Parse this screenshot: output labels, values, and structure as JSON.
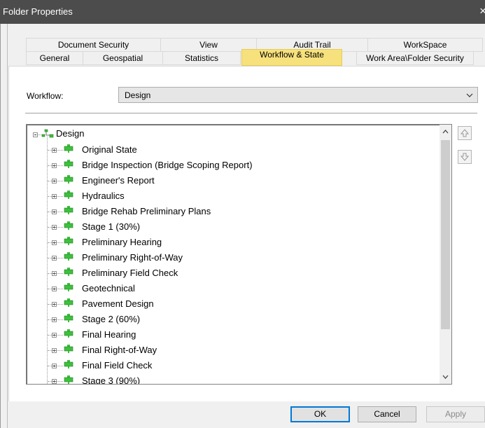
{
  "window": {
    "title": "Folder Properties",
    "close_glyph": "×"
  },
  "tabs": {
    "row1": [
      "Document Security",
      "View",
      "Audit Trail",
      "WorkSpace"
    ],
    "row2": [
      "General",
      "Geospatial",
      "Statistics",
      "Workflow & State",
      "Work Area\\Folder Security"
    ],
    "active": "Workflow & State"
  },
  "workflow": {
    "label": "Workflow:",
    "selected": "Design"
  },
  "tree": {
    "root": "Design",
    "states": [
      "Original State",
      "Bridge Inspection (Bridge Scoping Report)",
      "Engineer's Report",
      "Hydraulics",
      "Bridge Rehab Preliminary Plans",
      "Stage 1 (30%)",
      "Preliminary Hearing",
      "Preliminary Right-of-Way",
      "Preliminary Field Check",
      "Geotechnical",
      "Pavement Design",
      "Stage 2 (60%)",
      "Final Hearing",
      "Final Right-of-Way",
      "Final Field Check",
      "Stage 3 (90%)"
    ]
  },
  "buttons": {
    "ok": "OK",
    "cancel": "Cancel",
    "apply": "Apply"
  },
  "colors": {
    "active_tab": "#f7e17c",
    "node_green": "#3fbf3f"
  }
}
